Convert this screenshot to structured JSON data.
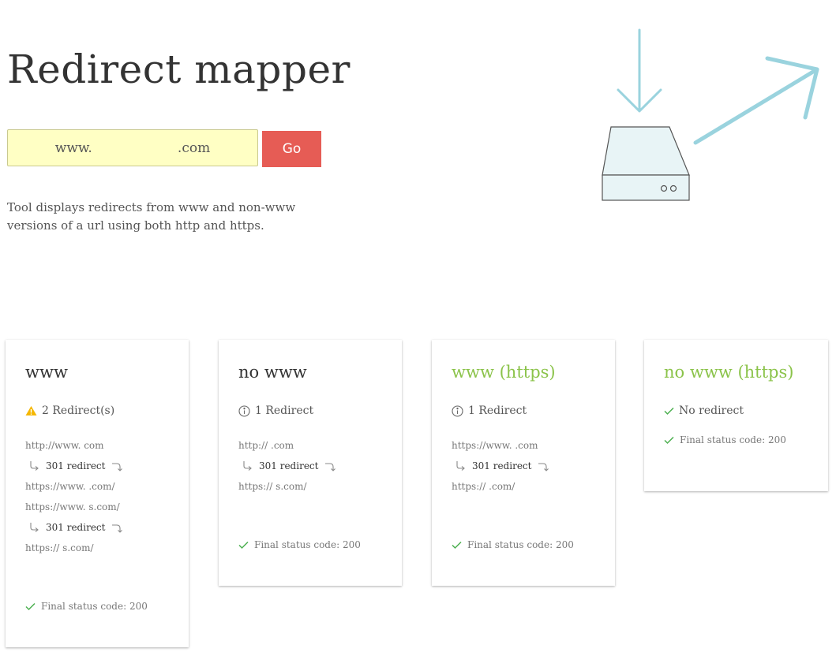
{
  "header": {
    "title": "Redirect mapper"
  },
  "search": {
    "value": "www.                    .com",
    "go_label": "Go"
  },
  "description": "Tool displays redirects from www and non-www versions of a url using both http and https.",
  "colors": {
    "accent_red": "#e65c55",
    "input_bg": "#ffffc4",
    "success_green": "#8bc34a",
    "check_green": "#4caf50",
    "warning_amber": "#f5b700",
    "illustration_blue": "#9ad3de"
  },
  "cards": [
    {
      "title": "www",
      "summary_icon": "warning-icon",
      "summary": "2 Redirect(s)",
      "chain": [
        {
          "type": "url",
          "text": "http://www.                            com"
        },
        {
          "type": "redirect",
          "text": "301 redirect"
        },
        {
          "type": "url",
          "text": "https://www.                            .com/"
        },
        {
          "type": "url",
          "text": "https://www.                           s.com/"
        },
        {
          "type": "redirect",
          "text": "301 redirect"
        },
        {
          "type": "url",
          "text": "https://                               s.com/"
        }
      ],
      "final": "Final status code: 200"
    },
    {
      "title": "no www",
      "summary_icon": "info-icon",
      "summary": "1 Redirect",
      "chain": [
        {
          "type": "url",
          "text": "http://                            .com"
        },
        {
          "type": "redirect",
          "text": "301 redirect"
        },
        {
          "type": "url",
          "text": "https://                            s.com/"
        }
      ],
      "final": "Final status code: 200"
    },
    {
      "title": "www (https)",
      "summary_icon": "info-icon",
      "summary": "1 Redirect",
      "chain": [
        {
          "type": "url",
          "text": "https://www.                            .com"
        },
        {
          "type": "redirect",
          "text": "301 redirect"
        },
        {
          "type": "url",
          "text": "https://                            .com/"
        }
      ],
      "final": "Final status code: 200"
    },
    {
      "title": "no www (https)",
      "summary_icon": "check-icon",
      "summary": "No redirect",
      "chain": [],
      "final": "Final status code: 200"
    }
  ]
}
